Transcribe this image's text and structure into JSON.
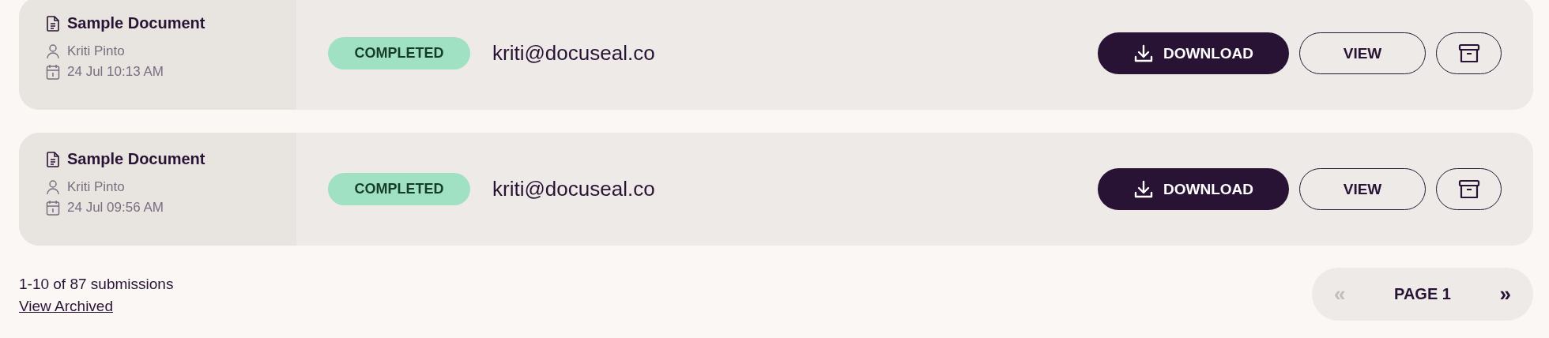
{
  "submissions": [
    {
      "title": "Sample Document",
      "submitter": "Kriti Pinto",
      "date": "24 Jul 10:13 AM",
      "status": "COMPLETED",
      "email": "kriti@docuseal.co",
      "actions": {
        "download": "DOWNLOAD",
        "view": "VIEW"
      }
    },
    {
      "title": "Sample Document",
      "submitter": "Kriti Pinto",
      "date": "24 Jul 09:56 AM",
      "status": "COMPLETED",
      "email": "kriti@docuseal.co",
      "actions": {
        "download": "DOWNLOAD",
        "view": "VIEW"
      }
    }
  ],
  "footer": {
    "count": "1-10 of 87 submissions",
    "archived_link": "View Archived"
  },
  "pagination": {
    "prev": {
      "label": "«",
      "disabled": true
    },
    "page": "PAGE 1",
    "next": {
      "label": "»",
      "disabled": false
    }
  }
}
